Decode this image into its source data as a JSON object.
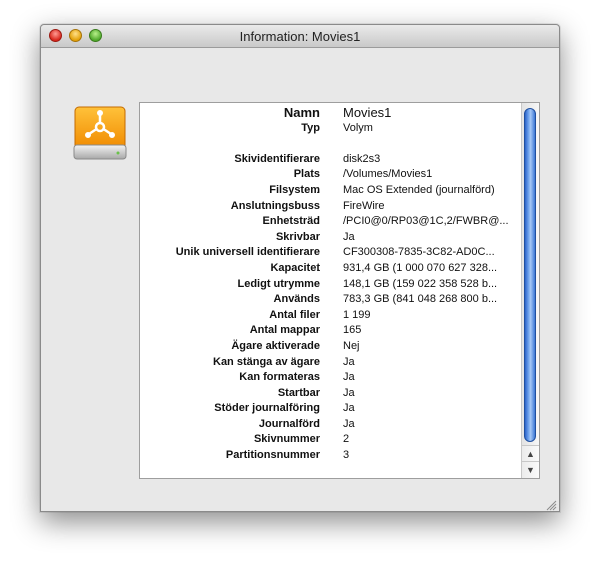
{
  "window": {
    "title": "Information: Movies1"
  },
  "icons": {
    "drive": "firewire-drive-icon"
  },
  "info": {
    "rows": [
      {
        "key": "Namn",
        "value": "Movies1"
      },
      {
        "key": "Typ",
        "value": "Volym"
      },
      {
        "key": "",
        "value": ""
      },
      {
        "key": "Skividentifierare",
        "value": "disk2s3"
      },
      {
        "key": "Plats",
        "value": "/Volumes/Movies1"
      },
      {
        "key": "Filsystem",
        "value": "Mac OS Extended (journalförd)"
      },
      {
        "key": "Anslutningsbuss",
        "value": "FireWire"
      },
      {
        "key": "Enhetsträd",
        "value": "/PCI0@0/RP03@1C,2/FWBR@..."
      },
      {
        "key": "Skrivbar",
        "value": "Ja"
      },
      {
        "key": "Unik universell identifierare",
        "value": "CF300308-7835-3C82-AD0C..."
      },
      {
        "key": "Kapacitet",
        "value": "931,4 GB (1 000 070 627 328..."
      },
      {
        "key": "Ledigt utrymme",
        "value": "148,1 GB (159 022 358 528 b..."
      },
      {
        "key": "Används",
        "value": "783,3 GB (841 048 268 800 b..."
      },
      {
        "key": "Antal filer",
        "value": "1 199"
      },
      {
        "key": "Antal mappar",
        "value": "165"
      },
      {
        "key": "Ägare aktiverade",
        "value": "Nej"
      },
      {
        "key": "Kan stänga av ägare",
        "value": "Ja"
      },
      {
        "key": "Kan formateras",
        "value": "Ja"
      },
      {
        "key": "Startbar",
        "value": "Ja"
      },
      {
        "key": "Stöder journalföring",
        "value": "Ja"
      },
      {
        "key": "Journalförd",
        "value": "Ja"
      },
      {
        "key": "Skivnummer",
        "value": "2"
      },
      {
        "key": "Partitionsnummer",
        "value": "3"
      }
    ],
    "separator": ":"
  }
}
